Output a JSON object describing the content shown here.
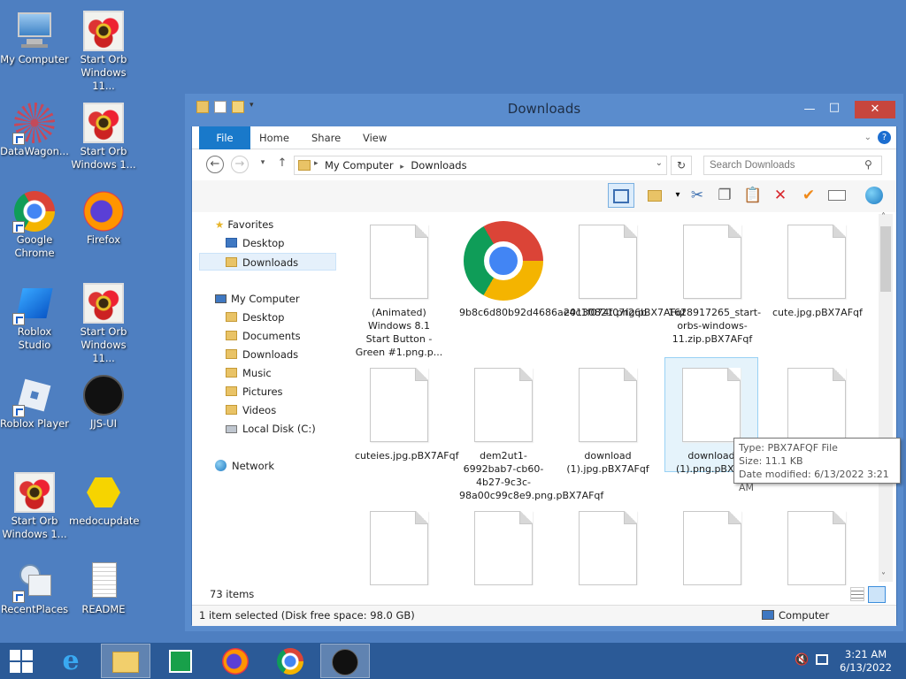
{
  "desktop": {
    "icons": [
      {
        "label": "My Computer",
        "icon": "computer-icon"
      },
      {
        "label": "Start Orb Windows 11...",
        "icon": "flower-image-icon"
      },
      {
        "label": "DataWagon...",
        "icon": "datawagon-icon"
      },
      {
        "label": "Start Orb Windows 1...",
        "icon": "flower-image-icon"
      },
      {
        "label": "Google Chrome",
        "icon": "chrome-icon"
      },
      {
        "label": "Firefox",
        "icon": "firefox-icon"
      },
      {
        "label": "Roblox Studio",
        "icon": "roblox-studio-icon"
      },
      {
        "label": "Start Orb Windows 11...",
        "icon": "flower-image-icon"
      },
      {
        "label": "Roblox Player",
        "icon": "roblox-player-icon"
      },
      {
        "label": "JJS-UI",
        "icon": "jjs-icon"
      },
      {
        "label": "Start Orb Windows 1...",
        "icon": "flower-image-icon"
      },
      {
        "label": "medocupdate",
        "icon": "medoc-icon"
      },
      {
        "label": "RecentPlaces",
        "icon": "recent-places-icon"
      },
      {
        "label": "README",
        "icon": "text-file-icon"
      }
    ]
  },
  "window": {
    "title": "Downloads",
    "controls": {
      "minimize": "—",
      "maximize": "□",
      "close": "✕"
    },
    "tabs": {
      "file": "File",
      "home": "Home",
      "share": "Share",
      "view": "View"
    },
    "address": {
      "root": "My Computer",
      "current": "Downloads",
      "sep": "▸"
    },
    "search_placeholder": "Search Downloads",
    "nav": {
      "favorites": "Favorites",
      "fav_items": [
        "Desktop",
        "Downloads"
      ],
      "computer": "My Computer",
      "computer_items": [
        "Desktop",
        "Documents",
        "Downloads",
        "Music",
        "Pictures",
        "Videos",
        "Local Disk (C:)"
      ],
      "network": "Network"
    },
    "files": [
      "(Animated) Windows 8.1 Start Button - Green #1.png.p...",
      "9b8c6d80b92d4686ae4c1f074f07f26b",
      "20130821.png.pBX7AFqf",
      "1628917265_start-orbs-windows-11.zip.pBX7AFqf",
      "cute.jpg.pBX7AFqf",
      "cuteies.jpg.pBX7AFqf",
      "dem2ut1-6992bab7-cb60-4b27-9c3c-98a00c99c8e9.png.pBX7AFqf",
      "download (1).jpg.pBX7AFqf",
      "download (1).png.pBX7A",
      "",
      "",
      "",
      "",
      "",
      ""
    ],
    "tooltip": {
      "type": "Type: PBX7AFQF File",
      "size": "Size: 11.1 KB",
      "modified": "Date modified: 6/13/2022 3:21 AM"
    },
    "item_count": "73 items",
    "status": "1 item selected (Disk free space: 98.0 GB)",
    "status_right": "Computer"
  },
  "taskbar": {
    "time": "3:21 AM",
    "date": "6/13/2022"
  },
  "colors": {
    "desktop": "#4e7fc1",
    "window_frame": "#5a8ccd",
    "file_tab": "#1979ca",
    "taskbar": "#2b5a97"
  }
}
